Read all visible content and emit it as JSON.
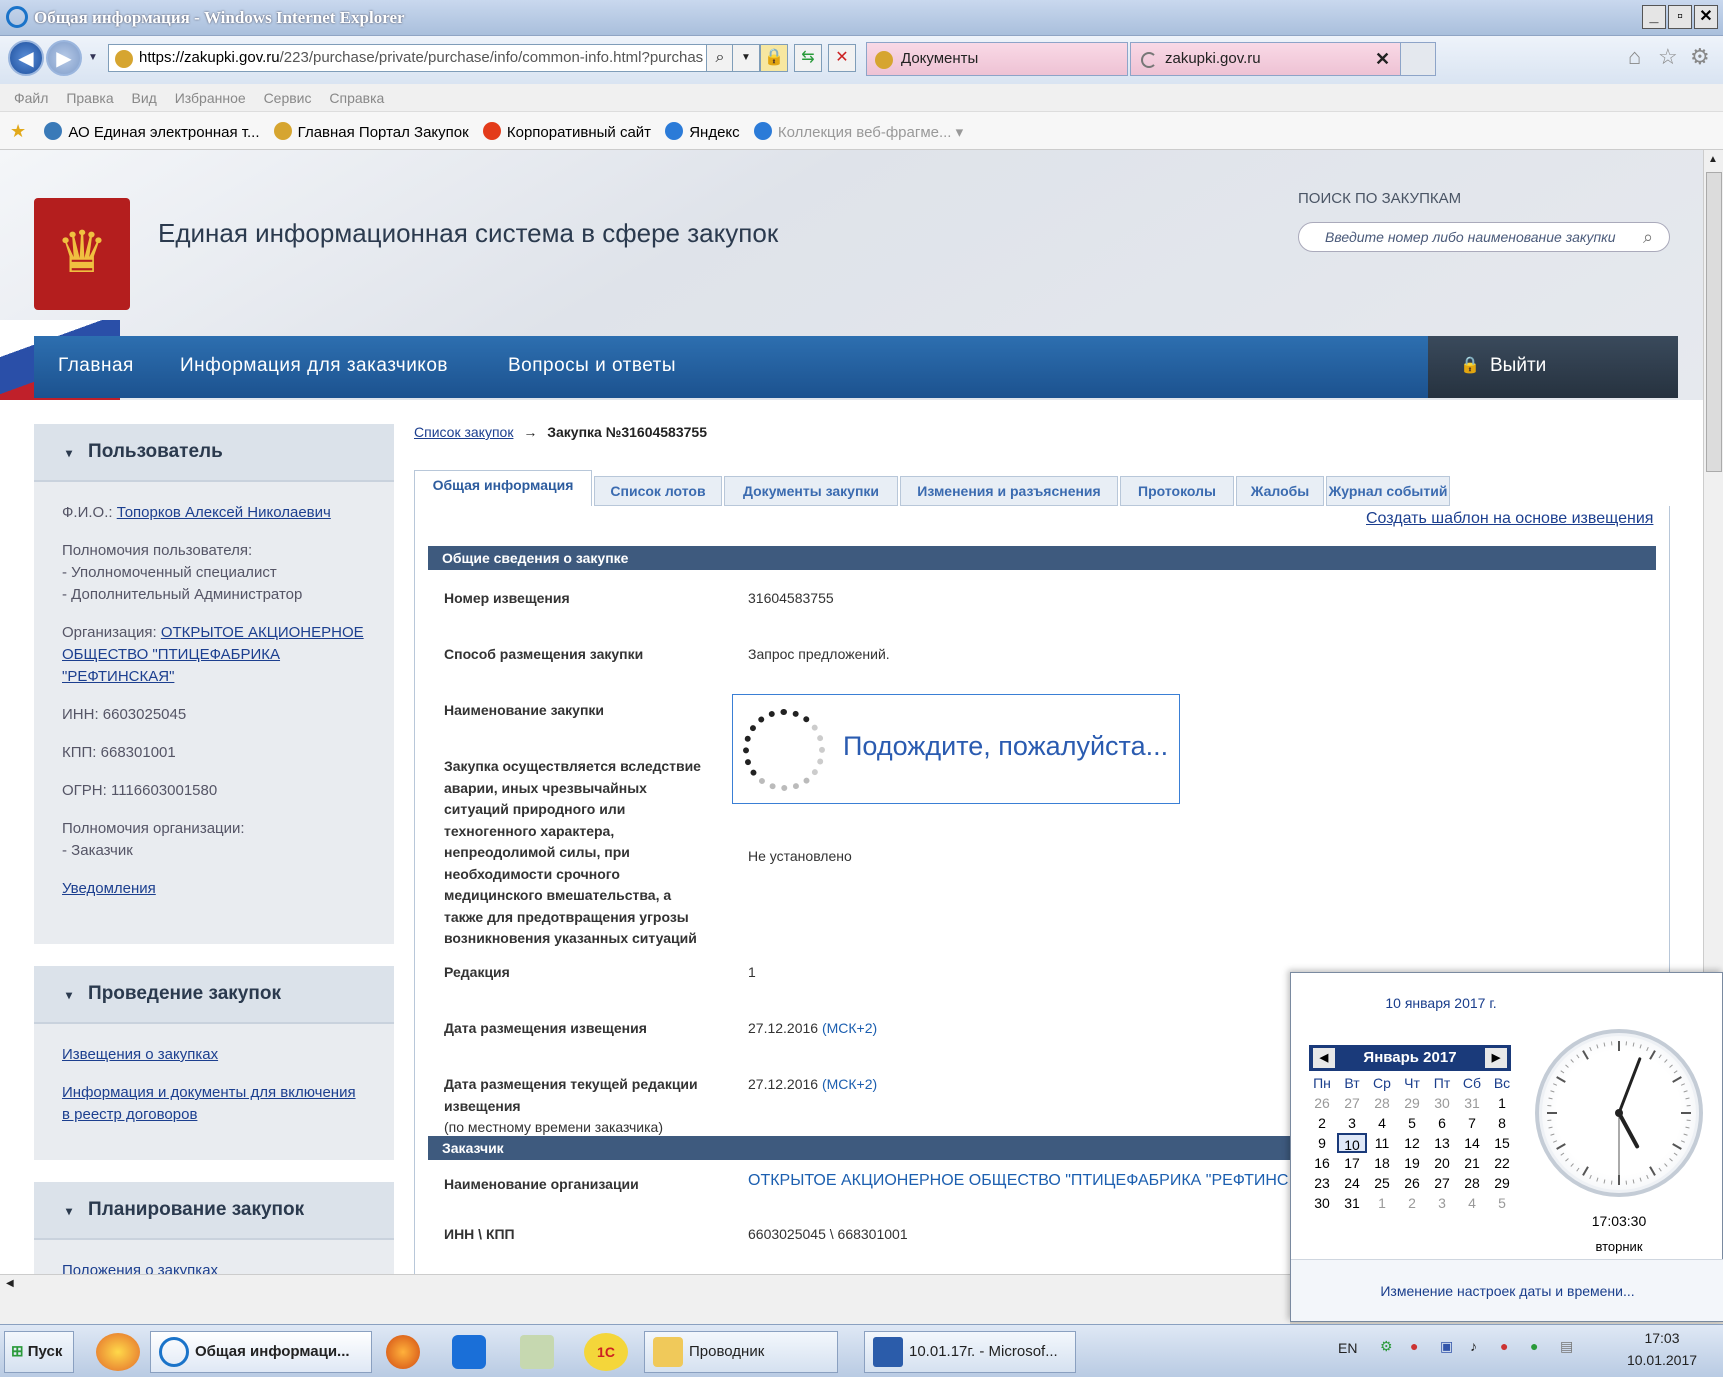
{
  "window": {
    "title": "Общая информация - Windows Internet Explorer"
  },
  "browser": {
    "url_host": "https://zakupki.gov.ru",
    "url_path": "/223/purchase/private/purchase/info/common-info.html?purchas",
    "tabs": [
      {
        "label": "Документы"
      },
      {
        "label": "zakupki.gov.ru"
      }
    ]
  },
  "menu": [
    "Файл",
    "Правка",
    "Вид",
    "Избранное",
    "Сервис",
    "Справка"
  ],
  "favorites": [
    {
      "label": "АО Единая электронная т...",
      "color": "#3a7ab8"
    },
    {
      "label": "Главная Портал Закупок",
      "color": "#d6a530"
    },
    {
      "label": "Корпоративный сайт",
      "color": "#e33b1a"
    },
    {
      "label": "Яндекс",
      "color": "#2b7bd8"
    },
    {
      "label": "Коллекция веб-фрагме...",
      "color": "#2b7bd8"
    }
  ],
  "site": {
    "title": "Единая информационная система в сфере закупок",
    "search_label": "ПОИСК ПО ЗАКУПКАМ",
    "search_placeholder": "Введите номер либо наименование закупки",
    "nav": [
      "Главная",
      "Информация для заказчиков",
      "Вопросы и ответы"
    ],
    "logout": "Выйти"
  },
  "sidebar": {
    "user": {
      "title": "Пользователь",
      "fio_label": "Ф.И.О.:",
      "fio": "Топорков Алексей Николаевич",
      "powers_label": "Полномочия пользователя:",
      "powers": [
        "- Уполномоченный специалист",
        "- Дополнительный Администратор"
      ],
      "org_label": "Организация:",
      "org": "ОТКРЫТОЕ АКЦИОНЕРНОЕ ОБЩЕСТВО \"ПТИЦЕФАБРИКА \"РЕФТИНСКАЯ\"",
      "inn": "ИНН: 6603025045",
      "kpp": "КПП: 668301001",
      "ogrn": "ОГРН: 1116603001580",
      "org_powers_label": "Полномочия организации:",
      "org_powers": "- Заказчик",
      "notifications": "Уведомления"
    },
    "conduct": {
      "title": "Проведение закупок",
      "links": [
        "Извещения о закупках",
        "Информация и документы для включения в реестр договоров"
      ]
    },
    "planning": {
      "title": "Планирование закупок",
      "links": [
        "Положения о закупках"
      ]
    }
  },
  "main": {
    "breadcrumb_link": "Список закупок",
    "breadcrumb_arrow": "→",
    "breadcrumb_current": "Закупка №31604583755",
    "tabs": [
      "Общая информация",
      "Список лотов",
      "Документы закупки",
      "Изменения и разъяснения",
      "Протоколы",
      "Жалобы",
      "Журнал событий"
    ],
    "template_link": "Создать шаблон на основе извещения",
    "section1": "Общие сведения о закупке",
    "fields": {
      "notice_no_label": "Номер извещения",
      "notice_no": "31604583755",
      "method_label": "Способ размещения закупки",
      "method": "Запрос предложений.",
      "name_label": "Наименование закупки",
      "emergency_label": "Закупка осуществляется вследствие аварии, иных чрезвычайных ситуаций природного или техногенного характера, непреодолимой силы, при необходимости срочного медицинского вмешательства, а также для предотвращения угрозы возникновения указанных ситуаций",
      "emergency": "Не установлено",
      "edition_label": "Редакция",
      "edition": "1",
      "pub_date_label": "Дата размещения извещения",
      "pub_date": "27.12.2016",
      "pub_tz": "(МСК+2)",
      "cur_date_label": "Дата размещения текущей редакции извещения",
      "cur_date_note": "(по местному времени заказчика)",
      "cur_date": "27.12.2016",
      "cur_tz": "(МСК+2)"
    },
    "section2": "Заказчик",
    "customer": {
      "name_label": "Наименование организации",
      "name": "ОТКРЫТОЕ АКЦИОНЕРНОЕ ОБЩЕСТВО \"ПТИЦЕФАБРИКА \"РЕФТИНС",
      "inn_label": "ИНН \\ КПП",
      "inn": "6603025045 \\ 668301001"
    },
    "loading": "Подождите, пожалуйста..."
  },
  "calendar": {
    "full_date": "10 января 2017 г.",
    "month": "Январь 2017",
    "weekdays": [
      "Пн",
      "Вт",
      "Ср",
      "Чт",
      "Пт",
      "Сб",
      "Вс"
    ],
    "weeks": [
      [
        "26",
        "27",
        "28",
        "29",
        "30",
        "31",
        "1"
      ],
      [
        "2",
        "3",
        "4",
        "5",
        "6",
        "7",
        "8"
      ],
      [
        "9",
        "10",
        "11",
        "12",
        "13",
        "14",
        "15"
      ],
      [
        "16",
        "17",
        "18",
        "19",
        "20",
        "21",
        "22"
      ],
      [
        "23",
        "24",
        "25",
        "26",
        "27",
        "28",
        "29"
      ],
      [
        "30",
        "31",
        "1",
        "2",
        "3",
        "4",
        "5"
      ]
    ],
    "today": "10",
    "time": "17:03:30",
    "day": "вторник",
    "change_link": "Изменение настроек даты и времени..."
  },
  "taskbar": {
    "start": "Пуск",
    "items": [
      "Общая информаци...",
      "Проводник",
      "10.01.17г. - Microsof..."
    ],
    "lang": "EN",
    "time": "17:03",
    "date": "10.01.2017"
  }
}
